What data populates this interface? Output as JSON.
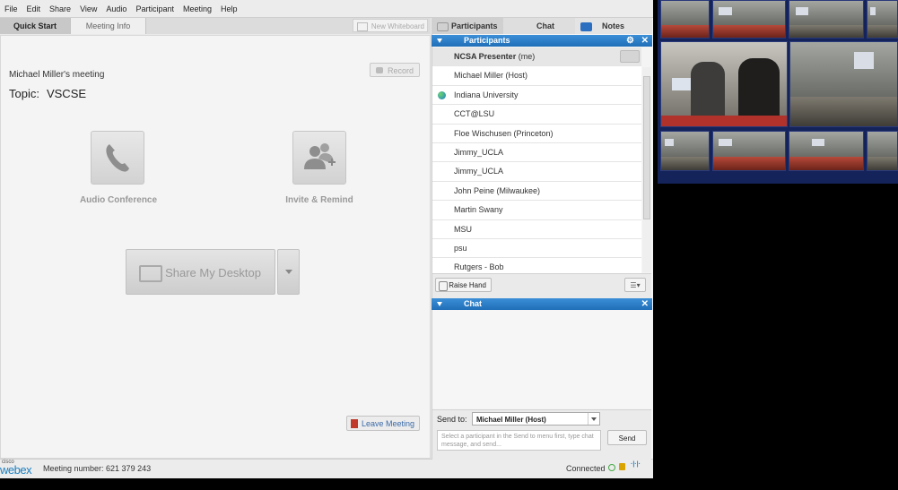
{
  "menu": [
    "File",
    "Edit",
    "Share",
    "View",
    "Audio",
    "Participant",
    "Meeting",
    "Help"
  ],
  "tabs": {
    "quick_start": "Quick Start",
    "meeting_info": "Meeting Info"
  },
  "new_whiteboard": "New Whiteboard",
  "meeting": {
    "title": "Michael Miller's meeting",
    "topic_label": "Topic:",
    "topic_value": "VSCSE",
    "record_label": "Record"
  },
  "actions": {
    "audio_conference": "Audio Conference",
    "invite_remind": "Invite & Remind",
    "share_desktop": "Share My Desktop",
    "leave_meeting": "Leave Meeting"
  },
  "right_tabs": {
    "participants": "Participants",
    "chat": "Chat",
    "notes": "Notes"
  },
  "participants_panel": {
    "header": "Participants",
    "list": [
      {
        "name": "NCSA Presenter",
        "suffix": "(me)"
      },
      {
        "name": "Michael Miller (Host)"
      },
      {
        "name": "Indiana University"
      },
      {
        "name": "CCT@LSU"
      },
      {
        "name": "Floe Wischusen (Princeton)"
      },
      {
        "name": "Jimmy_UCLA"
      },
      {
        "name": "Jimmy_UCLA"
      },
      {
        "name": "John Peine (Milwaukee)"
      },
      {
        "name": "Martin Swany"
      },
      {
        "name": "MSU"
      },
      {
        "name": "psu"
      },
      {
        "name": "Rutgers - Bob"
      }
    ],
    "raise_hand": "Raise Hand"
  },
  "chat_panel": {
    "header": "Chat",
    "send_to_label": "Send to:",
    "send_to_value": "Michael Miller (Host)",
    "input_placeholder": "Select a participant in the Send to menu first, type chat message, and send...",
    "send_button": "Send"
  },
  "status": {
    "brand_small": "cisco",
    "brand": "webex",
    "meeting_number": "Meeting number: 621 379 243",
    "connected": "Connected"
  }
}
